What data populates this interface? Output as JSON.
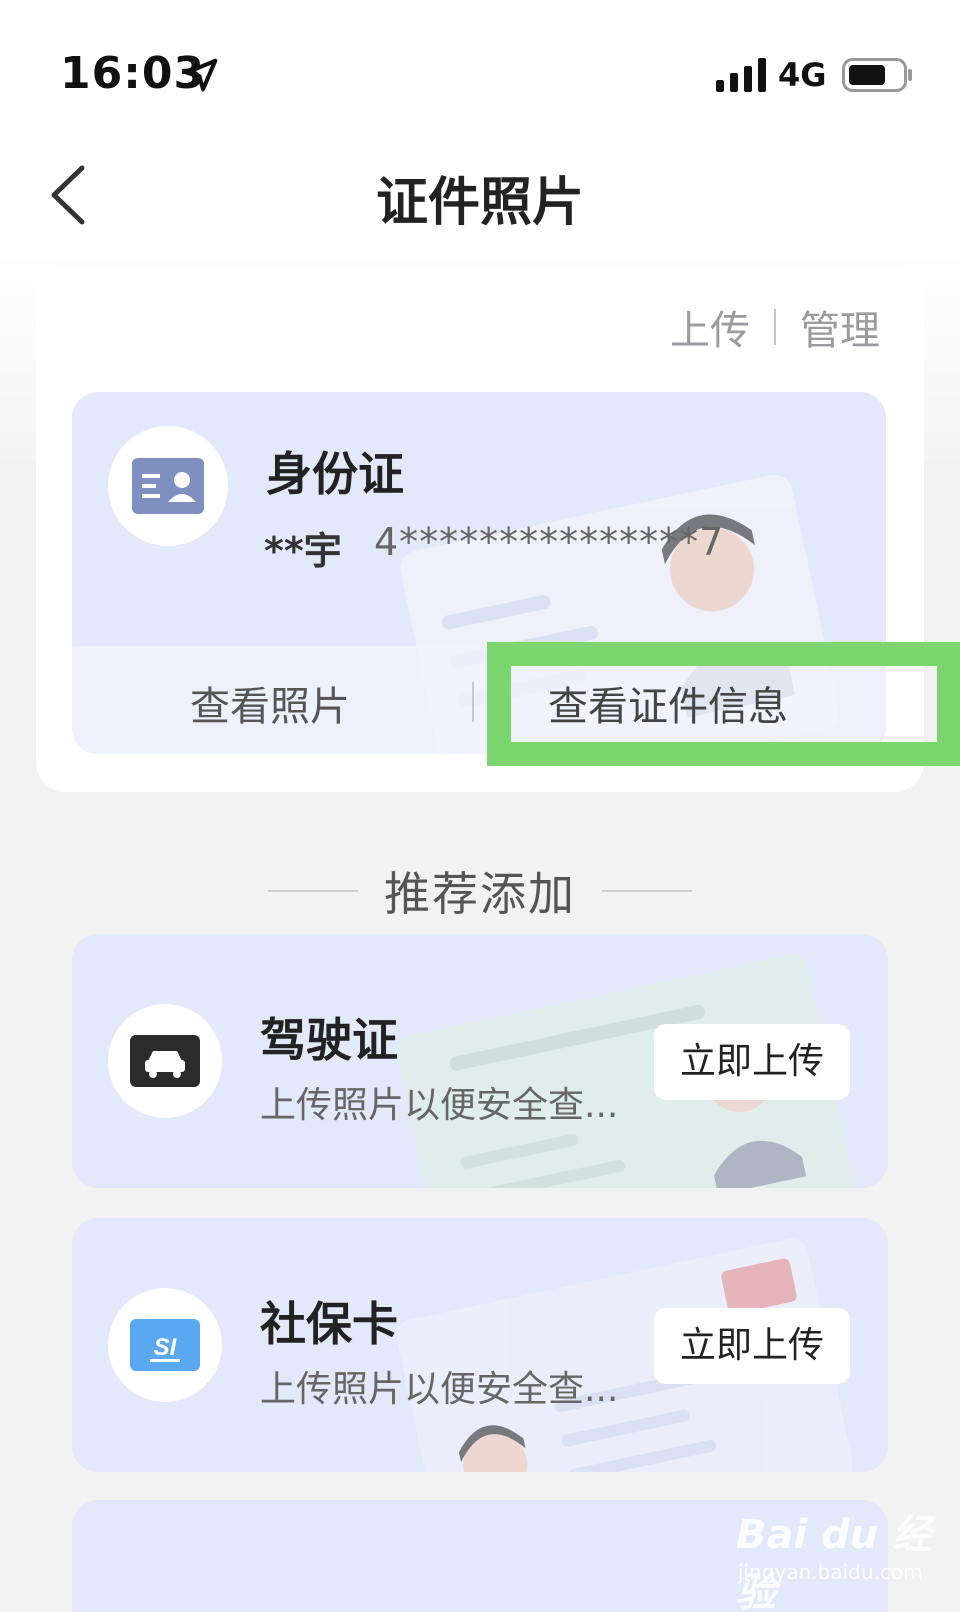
{
  "status_bar": {
    "time": "16:03",
    "network": "4G"
  },
  "nav": {
    "title": "证件照片"
  },
  "card_actions": {
    "upload": "上传",
    "manage": "管理"
  },
  "id_card": {
    "title": "身份证",
    "name": "**宇",
    "number": "4***************7",
    "view_photo": "查看照片",
    "view_info": "查看证件信息"
  },
  "section": {
    "title": "推荐添加"
  },
  "recommend": [
    {
      "title": "驾驶证",
      "subtitle": "上传照片以便安全查...",
      "button": "立即上传",
      "icon": "car-icon"
    },
    {
      "title": "社保卡",
      "subtitle": "上传照片以便安全查...",
      "button": "立即上传",
      "icon": "social-security-icon"
    }
  ],
  "watermark": {
    "main": "Bai du 经验",
    "sub": "jingyan.baidu.com"
  },
  "colors": {
    "highlight": "#7dd56f",
    "card_bg": "#e3e8fa",
    "page_bg": "#f2f2f3"
  }
}
